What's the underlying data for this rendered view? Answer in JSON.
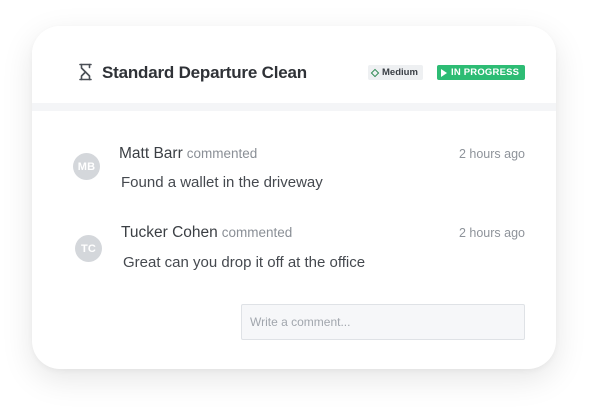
{
  "task": {
    "title": "Standard Departure Clean",
    "icon": "hourglass-icon",
    "priority_label": "Medium",
    "priority_icon": "diamond-icon",
    "status_label": "IN PROGRESS",
    "status_icon": "play-icon",
    "status_color": "#2dbc74"
  },
  "comments": [
    {
      "initials": "MB",
      "author": "Matt Barr",
      "action": "commented",
      "time": "2 hours ago",
      "text": "Found a wallet in the driveway"
    },
    {
      "initials": "TC",
      "author": "Tucker Cohen",
      "action": "commented",
      "time": "2 hours ago",
      "text": "Great can you drop it off at the office"
    }
  ],
  "comment_input": {
    "placeholder": "Write a comment...",
    "value": ""
  }
}
